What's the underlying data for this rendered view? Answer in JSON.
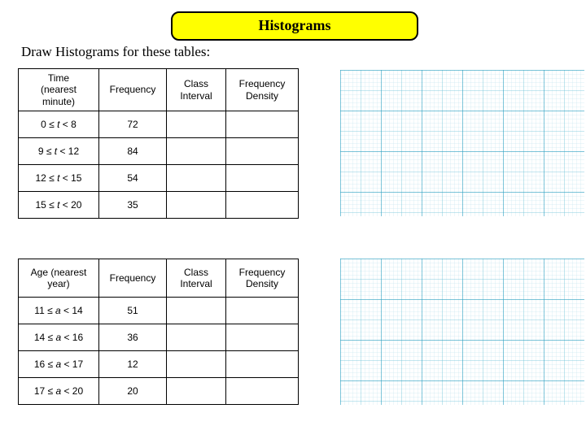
{
  "title": "Histograms",
  "instruction": "Draw Histograms for these tables:",
  "table1": {
    "headers": {
      "label_l1": "Time",
      "label_l2": "(nearest",
      "label_l3": "minute)",
      "freq": "Frequency",
      "ci_l1": "Class",
      "ci_l2": "Interval",
      "fd_l1": "Frequency",
      "fd_l2": "Density"
    },
    "rows": [
      {
        "range_pre": "0 ≤ ",
        "range_var": "t",
        "range_post": " < 8",
        "freq": "72"
      },
      {
        "range_pre": "9 ≤ ",
        "range_var": "t",
        "range_post": " < 12",
        "freq": "84"
      },
      {
        "range_pre": "12 ≤ ",
        "range_var": "t",
        "range_post": " < 15",
        "freq": "54"
      },
      {
        "range_pre": "15 ≤ ",
        "range_var": "t",
        "range_post": " < 20",
        "freq": "35"
      }
    ]
  },
  "table2": {
    "headers": {
      "label_l1": "Age (nearest",
      "label_l2": "year)",
      "freq": "Frequency",
      "ci_l1": "Class",
      "ci_l2": "Interval",
      "fd_l1": "Frequency",
      "fd_l2": "Density"
    },
    "rows": [
      {
        "range_pre": "11 ≤ ",
        "range_var": "a",
        "range_post": " < 14",
        "freq": "51"
      },
      {
        "range_pre": "14 ≤ ",
        "range_var": "a",
        "range_post": " < 16",
        "freq": "36"
      },
      {
        "range_pre": "16 ≤ ",
        "range_var": "a",
        "range_post": " < 17",
        "freq": "12"
      },
      {
        "range_pre": "17 ≤ ",
        "range_var": "a",
        "range_post": " < 20",
        "freq": "20"
      }
    ]
  }
}
